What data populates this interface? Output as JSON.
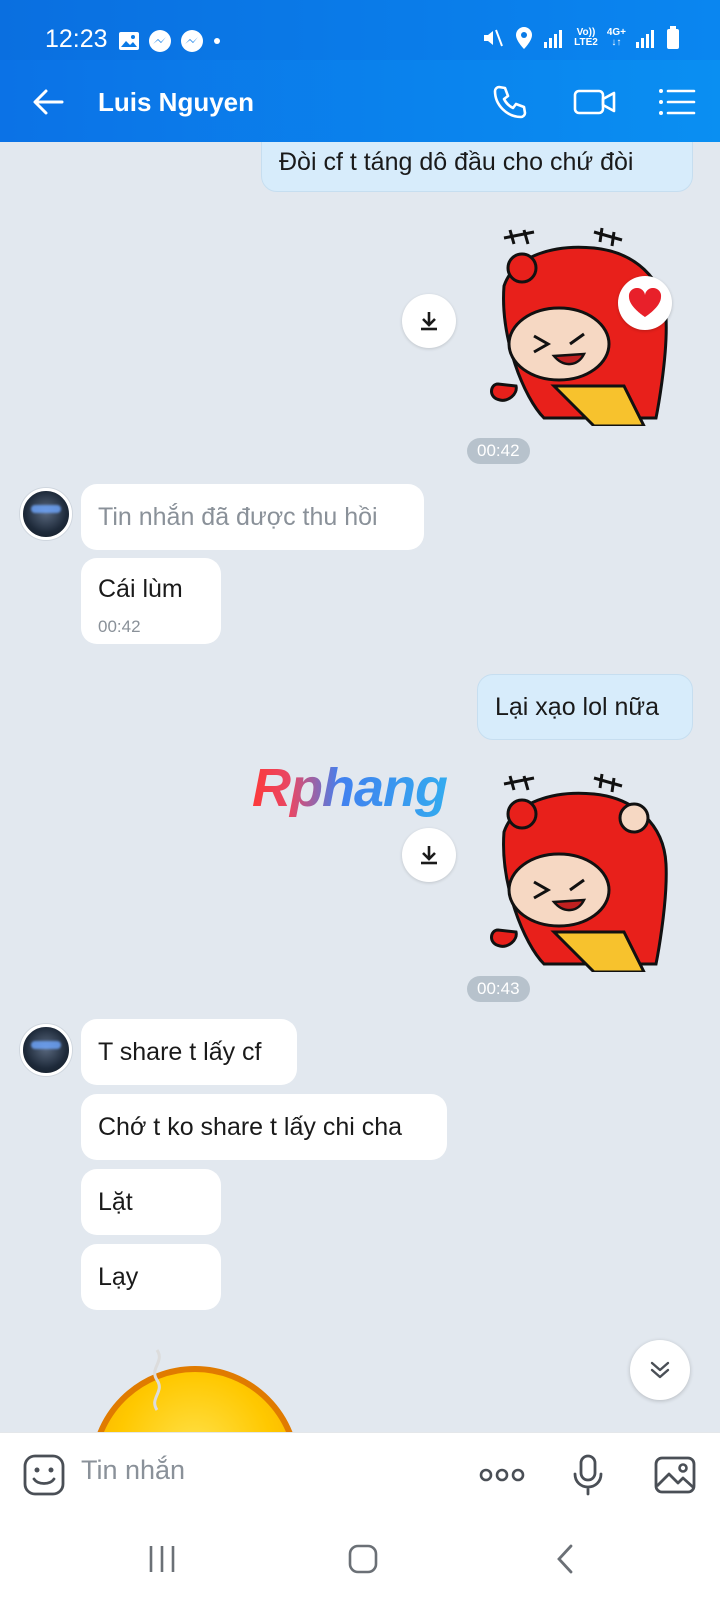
{
  "status_bar": {
    "time": "12:23",
    "network_top": "Vo))",
    "network_bottom": "LTE2",
    "gen_top": "4G+",
    "gen_bottom": "↓↑"
  },
  "header": {
    "title": "Luis Nguyen"
  },
  "messages": {
    "m1": "Đòi cf t táng dô đầu cho chứ đòi",
    "t1": "00:42",
    "m2": "Tin nhắn đã được thu hồi",
    "m3": "Cái lùm",
    "m3_time": "00:42",
    "m4": "Lại xạo lol nữa",
    "t2": "00:43",
    "m5": "T share t lấy cf",
    "m6": "Chớ t ko share t lấy chi cha",
    "m7": "Lặt",
    "m8": "Lạy"
  },
  "watermark": "Rphang",
  "input": {
    "placeholder": "Tin nhắn"
  },
  "colors": {
    "header": "#0a86f0",
    "outgoing_bubble": "#d7ecfb",
    "incoming_bubble": "#ffffff",
    "chat_bg": "#e2e8ef"
  }
}
